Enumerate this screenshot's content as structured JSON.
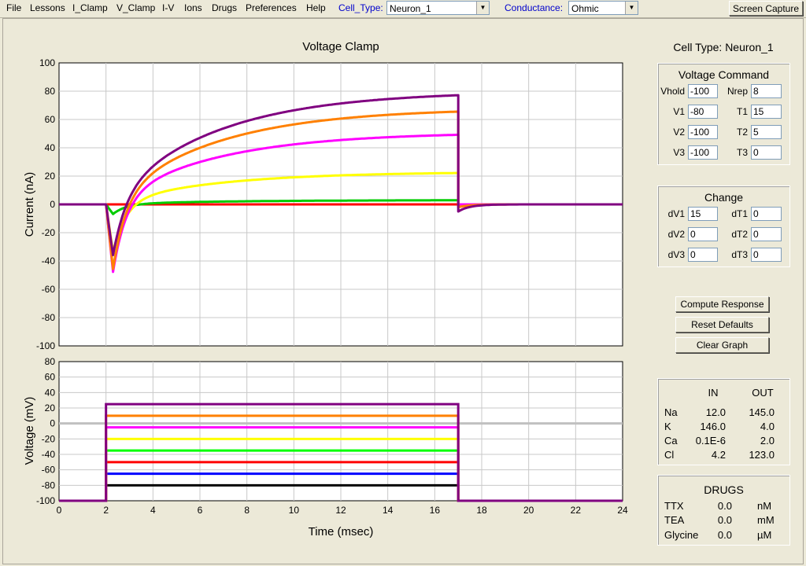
{
  "menu": {
    "items": [
      "File",
      "Lessons",
      "I_Clamp",
      "V_Clamp",
      "I-V",
      "Ions",
      "Drugs",
      "Preferences",
      "Help"
    ],
    "cell_type_label": "Cell_Type:",
    "cell_type_value": "Neuron_1",
    "conductance_label": "Conductance:",
    "conductance_value": "Ohmic",
    "screen_capture": "Screen Capture"
  },
  "plot": {
    "title": "Voltage Clamp",
    "current_ylabel": "Current (nA)",
    "voltage_ylabel": "Voltage (mV)",
    "xlabel": "Time (msec)"
  },
  "cell_type_display": "Cell Type: Neuron_1",
  "voltage_command": {
    "title": "Voltage Command",
    "fields": [
      {
        "label": "Vhold",
        "value": "-100"
      },
      {
        "label": "Nrep",
        "value": "8"
      },
      {
        "label": "V1",
        "value": "-80"
      },
      {
        "label": "T1",
        "value": "15"
      },
      {
        "label": "V2",
        "value": "-100"
      },
      {
        "label": "T2",
        "value": "5"
      },
      {
        "label": "V3",
        "value": "-100"
      },
      {
        "label": "T3",
        "value": "0"
      }
    ]
  },
  "change": {
    "title": "Change",
    "fields": [
      {
        "label": "dV1",
        "value": "15"
      },
      {
        "label": "dT1",
        "value": "0"
      },
      {
        "label": "dV2",
        "value": "0"
      },
      {
        "label": "dT2",
        "value": "0"
      },
      {
        "label": "dV3",
        "value": "0"
      },
      {
        "label": "dT3",
        "value": "0"
      }
    ]
  },
  "buttons": {
    "compute": "Compute Response",
    "reset": "Reset Defaults",
    "clear": "Clear Graph"
  },
  "ions": {
    "header_in": "IN",
    "header_out": "OUT",
    "rows": [
      {
        "ion": "Na",
        "in": "12.0",
        "out": "145.0"
      },
      {
        "ion": "K",
        "in": "146.0",
        "out": "4.0"
      },
      {
        "ion": "Ca",
        "in": "0.1E-6",
        "out": "2.0"
      },
      {
        "ion": "Cl",
        "in": "4.2",
        "out": "123.0"
      }
    ]
  },
  "drugs": {
    "title": "DRUGS",
    "rows": [
      {
        "name": "TTX",
        "value": "0.0",
        "unit": "nM"
      },
      {
        "name": "TEA",
        "value": "0.0",
        "unit": "mM"
      },
      {
        "name": "Glycine",
        "value": "0.0",
        "unit": "µM"
      }
    ]
  },
  "chart_data": [
    {
      "type": "line",
      "title": "Voltage Clamp",
      "xlabel": "Time (msec)",
      "ylabel": "Current (nA)",
      "xlim": [
        0,
        24
      ],
      "ylim": [
        -100,
        100
      ],
      "xticks": [
        0,
        2,
        4,
        6,
        8,
        10,
        12,
        14,
        16,
        18,
        20,
        22,
        24
      ],
      "yticks": [
        -100,
        -80,
        -60,
        -40,
        -20,
        0,
        20,
        40,
        60,
        80,
        100
      ],
      "grid": true,
      "series": [
        {
          "color": "#ff0000",
          "steady": 0,
          "peak": 0,
          "tail": 0
        },
        {
          "color": "#00cc00",
          "steady": 3,
          "peak": -7,
          "tail": -1
        },
        {
          "color": "#ffff00",
          "steady": 23,
          "peak": -35,
          "tail": 0
        },
        {
          "color": "#ff00ff",
          "steady": 51,
          "peak": -51,
          "tail": 0
        },
        {
          "color": "#ff8000",
          "steady": 68,
          "peak": -50,
          "tail": -2
        },
        {
          "color": "#800080",
          "steady": 80,
          "peak": -41,
          "tail": -5
        }
      ]
    },
    {
      "type": "line",
      "xlabel": "Time (msec)",
      "ylabel": "Voltage (mV)",
      "xlim": [
        0,
        24
      ],
      "ylim": [
        -100,
        80
      ],
      "xticks": [
        0,
        2,
        4,
        6,
        8,
        10,
        12,
        14,
        16,
        18,
        20,
        22,
        24
      ],
      "yticks": [
        -100,
        -80,
        -60,
        -40,
        -20,
        0,
        20,
        40,
        60,
        80
      ],
      "grid": true,
      "hold_mV": -100,
      "step_start_ms": 2,
      "step_end_ms": 17,
      "series": [
        {
          "color": "#000000",
          "step_mV": -80
        },
        {
          "color": "#0000ff",
          "step_mV": -65
        },
        {
          "color": "#ff0000",
          "step_mV": -50
        },
        {
          "color": "#00ff00",
          "step_mV": -35
        },
        {
          "color": "#ffff00",
          "step_mV": -20
        },
        {
          "color": "#ff00ff",
          "step_mV": -5
        },
        {
          "color": "#ff8000",
          "step_mV": 10
        },
        {
          "color": "#800080",
          "step_mV": 25
        }
      ],
      "reference_line": {
        "color": "#c0c0c0",
        "value_mV": 0
      }
    }
  ]
}
